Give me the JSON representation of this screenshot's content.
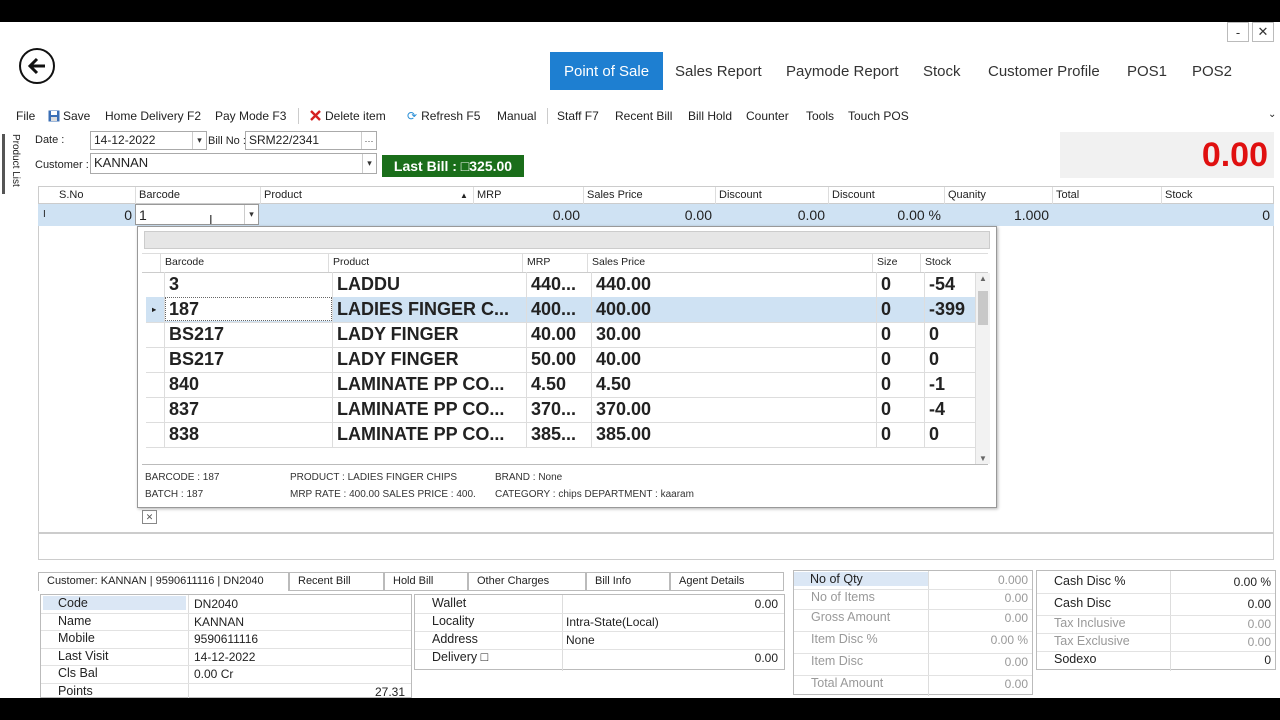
{
  "window": {
    "minimize": "-",
    "maximize": "□",
    "close": "✕"
  },
  "nav": {
    "active": "Point of Sale",
    "items": [
      "Sales Report",
      "Paymode Report",
      "Stock",
      "Customer Profile",
      "POS1",
      "POS2"
    ]
  },
  "toolbar": {
    "file": "File",
    "save": "Save",
    "home_delivery": "Home Delivery F2",
    "pay_mode": "Pay Mode F3",
    "delete_item": "Delete item",
    "refresh": "Refresh F5",
    "manual": "Manual",
    "staff": "Staff F7",
    "recent_bill": "Recent Bill",
    "bill_hold": "Bill Hold",
    "counter": "Counter",
    "tools": "Tools",
    "touch_pos": "Touch POS"
  },
  "side_tab": "Product List",
  "form": {
    "date_label": "Date :",
    "date_value": "14-12-2022",
    "billno_label": "Bill No :",
    "billno_value": "SRM22/2341",
    "browse": "···",
    "customer_label": "Customer :",
    "customer_value": "KANNAN",
    "last_bill": "Last Bill : □325.00",
    "total_display": "0.00"
  },
  "grid": {
    "headers": [
      "S.No",
      "Barcode",
      "Product",
      "MRP",
      "Sales Price",
      "Discount",
      "Discount",
      "Quanity",
      "Total",
      "Stock"
    ],
    "row": {
      "sno": "0",
      "barcode": "1",
      "mrp": "0.00",
      "sales_price": "0.00",
      "discount": "0.00",
      "discount_pct": "0.00 %",
      "quantity": "1.000",
      "stock": "0"
    }
  },
  "popup": {
    "headers": [
      "Barcode",
      "Product",
      "MRP",
      "Sales Price",
      "Size",
      "Stock"
    ],
    "rows": [
      {
        "barcode": "3",
        "product": "LADDU",
        "mrp": "440...",
        "sales_price": "440.00",
        "size": "0",
        "stock": "-54"
      },
      {
        "barcode": "187",
        "product": "LADIES FINGER C...",
        "mrp": "400...",
        "sales_price": "400.00",
        "size": "0",
        "stock": "-399"
      },
      {
        "barcode": "BS217",
        "product": "LADY FINGER",
        "mrp": "40.00",
        "sales_price": "30.00",
        "size": "0",
        "stock": "0"
      },
      {
        "barcode": "BS217",
        "product": "LADY FINGER",
        "mrp": "50.00",
        "sales_price": "40.00",
        "size": "0",
        "stock": "0"
      },
      {
        "barcode": "840",
        "product": "LAMINATE PP CO...",
        "mrp": "4.50",
        "sales_price": "4.50",
        "size": "0",
        "stock": "-1"
      },
      {
        "barcode": "837",
        "product": "LAMINATE PP CO...",
        "mrp": "370...",
        "sales_price": "370.00",
        "size": "0",
        "stock": "-4"
      },
      {
        "barcode": "838",
        "product": "LAMINATE PP CO...",
        "mrp": "385...",
        "sales_price": "385.00",
        "size": "0",
        "stock": "0"
      }
    ],
    "info": {
      "barcode": "BARCODE : 187",
      "batch": "BATCH : 187",
      "product": "PRODUCT : LADIES FINGER CHIPS",
      "rates": "MRP RATE : 400.00 SALES PRICE : 400.",
      "brand": "BRAND : None",
      "category": "CATEGORY : chips  DEPARTMENT : kaaram"
    },
    "close": "✕"
  },
  "bottom_tabs": [
    "Customer: KANNAN | 9590611116 | DN2040",
    "Recent Bill",
    "Hold Bill",
    "Other Charges",
    "Bill Info",
    "Agent Details"
  ],
  "customer": [
    {
      "k": "Code",
      "v": "DN2040"
    },
    {
      "k": "Name",
      "v": "KANNAN"
    },
    {
      "k": "Mobile",
      "v": "9590611116"
    },
    {
      "k": "Last Visit",
      "v": "14-12-2022"
    },
    {
      "k": "Cls Bal",
      "v": "0.00 Cr"
    },
    {
      "k": "Points",
      "v": "27.31"
    }
  ],
  "wallet": [
    {
      "k": "Wallet",
      "v": "0.00"
    },
    {
      "k": "Locality",
      "v": "Intra-State(Local)"
    },
    {
      "k": "Address",
      "v": "None"
    },
    {
      "k": "Delivery □",
      "v": "0.00"
    }
  ],
  "summary": [
    {
      "k": "No of Qty",
      "v": "0.000"
    },
    {
      "k": "No of Items",
      "v": "0.00"
    },
    {
      "k": "Gross Amount",
      "v": "0.00"
    },
    {
      "k": "Item Disc %",
      "v": "0.00 %"
    },
    {
      "k": "Item Disc",
      "v": "0.00"
    },
    {
      "k": "Total Amount",
      "v": "0.00"
    }
  ],
  "cash": [
    {
      "k": "Cash Disc %",
      "v": "0.00 %"
    },
    {
      "k": "Cash Disc",
      "v": "0.00"
    },
    {
      "k": "Tax Inclusive",
      "v": "0.00"
    },
    {
      "k": "Tax Exclusive",
      "v": "0.00"
    },
    {
      "k": "Sodexo",
      "v": "0"
    }
  ]
}
